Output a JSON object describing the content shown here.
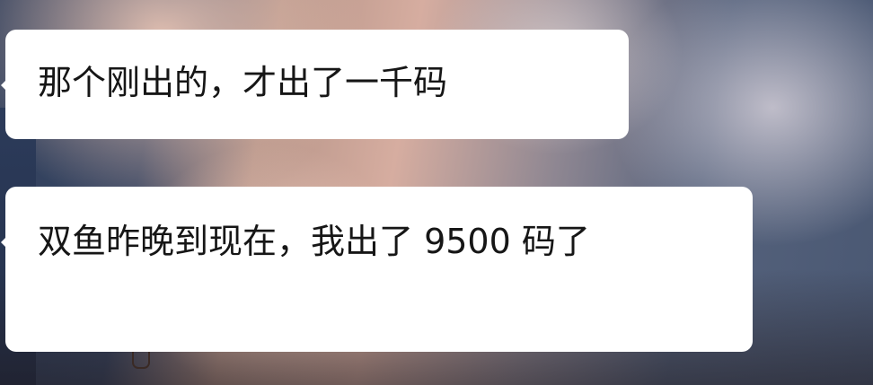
{
  "messages": [
    {
      "text": "那个刚出的，才出了一千码"
    },
    {
      "text": "双鱼昨晚到现在，我出了 9500 码了"
    }
  ],
  "colors": {
    "bubble_background": "#ffffff",
    "text": "#161616"
  }
}
